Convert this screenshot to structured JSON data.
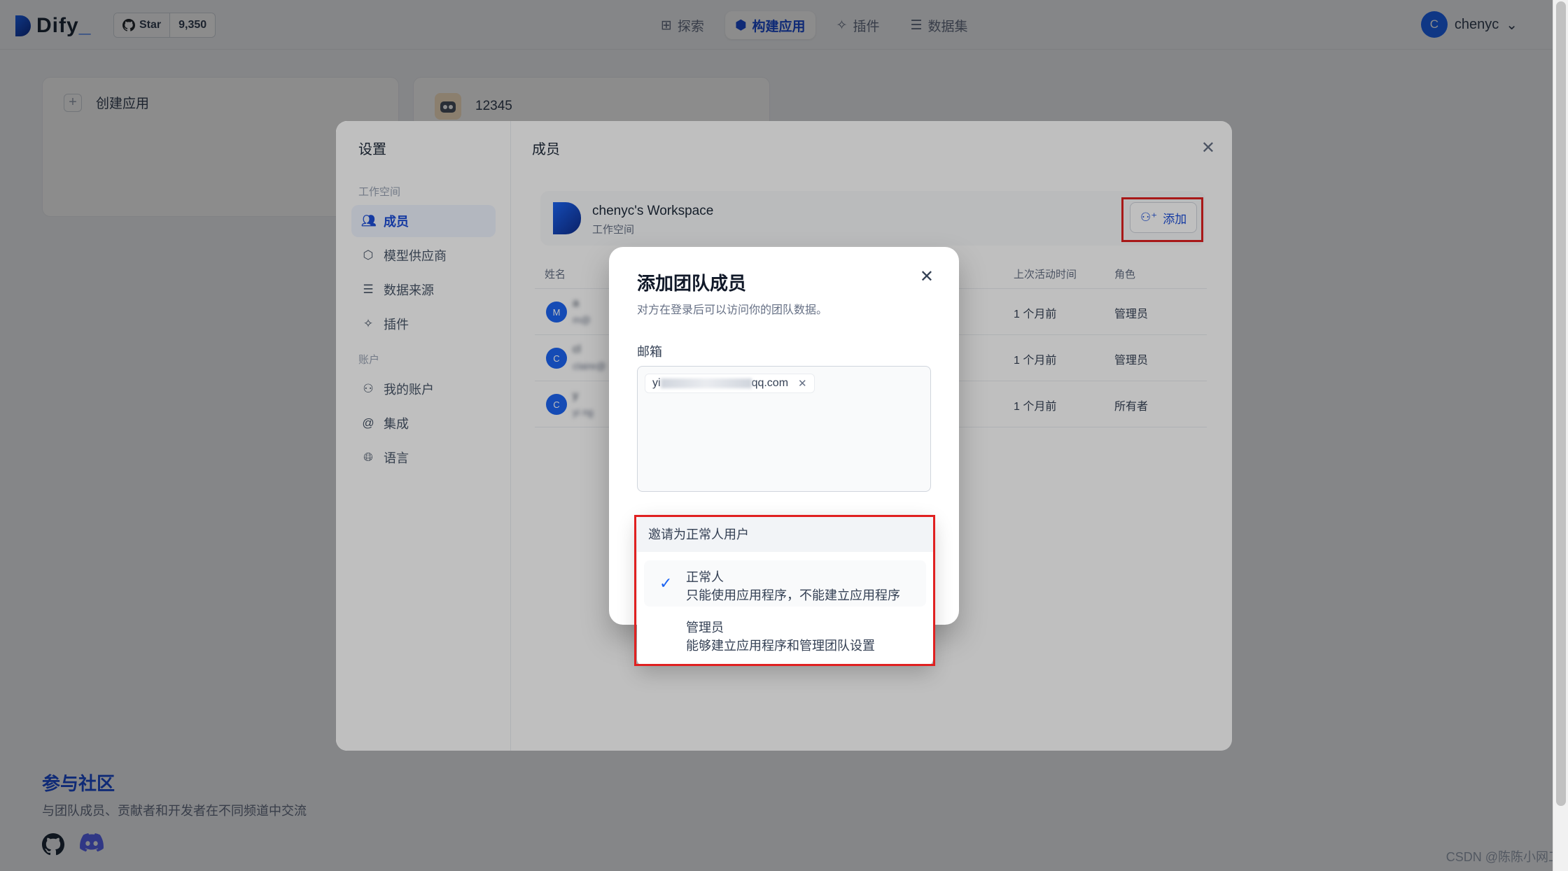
{
  "brand": {
    "name": "Dify",
    "accent": "#1c64f2"
  },
  "github": {
    "star_label": "Star",
    "count": "9,350"
  },
  "nav": {
    "tabs": [
      {
        "label": "探索",
        "icon": "grid-icon"
      },
      {
        "label": "构建应用",
        "icon": "cube-icon",
        "active": true
      },
      {
        "label": "插件",
        "icon": "puzzle-icon"
      },
      {
        "label": "数据集",
        "icon": "database-icon"
      }
    ]
  },
  "user": {
    "initial": "C",
    "name": "chenyc"
  },
  "apps": {
    "create_label": "创建应用",
    "app_name": "12345"
  },
  "community": {
    "title": "参与社区",
    "desc": "与团队成员、贡献者和开发者在不同频道中交流"
  },
  "watermark": "CSDN @陈陈小网工",
  "settings": {
    "title": "设置",
    "group_workspace": "工作空间",
    "group_account": "账户",
    "items": [
      {
        "label": "成员",
        "icon": "users-icon",
        "active": true
      },
      {
        "label": "模型供应商",
        "icon": "cube-icon"
      },
      {
        "label": "数据来源",
        "icon": "database-icon"
      },
      {
        "label": "插件",
        "icon": "puzzle-icon"
      },
      {
        "label": "我的账户",
        "icon": "user-icon"
      },
      {
        "label": "集成",
        "icon": "at-icon"
      },
      {
        "label": "语言",
        "icon": "globe-icon"
      }
    ],
    "section_title": "成员",
    "workspace_name": "chenyc's Workspace",
    "workspace_sub": "工作空间",
    "add_label": "添加",
    "columns": {
      "name": "姓名",
      "last_active": "上次活动时间",
      "role": "角色"
    },
    "members": [
      {
        "initial": "M",
        "name": "a",
        "email": "m@",
        "last_active": "1 个月前",
        "role": "管理员"
      },
      {
        "initial": "C",
        "name": "cl",
        "email": "claire@",
        "last_active": "1 个月前",
        "role": "管理员"
      },
      {
        "initial": "C",
        "name": "y",
        "email": "yi ng",
        "last_active": "1 个月前",
        "role": "所有者"
      }
    ]
  },
  "invite": {
    "title": "添加团队成员",
    "subtitle": "对方在登录后可以访问你的团队数据。",
    "email_label": "邮箱",
    "email_prefix": "yi",
    "email_suffix": "qq.com",
    "role_header": "邀请为正常人用户",
    "options": [
      {
        "name": "正常人",
        "desc": "只能使用应用程序，不能建立应用程序",
        "selected": true
      },
      {
        "name": "管理员",
        "desc": "能够建立应用程序和管理团队设置",
        "selected": false
      }
    ]
  }
}
